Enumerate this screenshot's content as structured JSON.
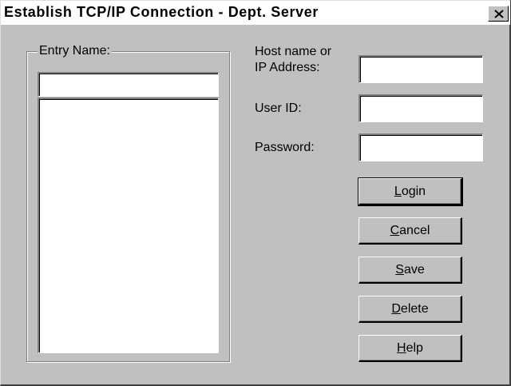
{
  "window": {
    "title": "Establish TCP/IP Connection - Dept. Server",
    "close_icon": "close-icon"
  },
  "entry_group": {
    "label": "Entry Name:",
    "input_value": "",
    "list_items": []
  },
  "fields": {
    "host_label_line1": "Host name or",
    "host_label_line2": "IP Address:",
    "host_value": "",
    "user_label": "User ID:",
    "user_value": "",
    "password_label": "Password:",
    "password_value": ""
  },
  "buttons": {
    "login": {
      "accel": "L",
      "rest": "ogin"
    },
    "cancel": {
      "accel": "C",
      "rest": "ancel"
    },
    "save": {
      "accel": "S",
      "rest": "ave"
    },
    "delete": {
      "accel": "D",
      "rest": "elete"
    },
    "help": {
      "accel": "H",
      "rest": "elp"
    }
  },
  "colors": {
    "dialog_face": "#c0c0c0",
    "title_bar": "#ffffff",
    "field_bg": "#ffffff"
  }
}
